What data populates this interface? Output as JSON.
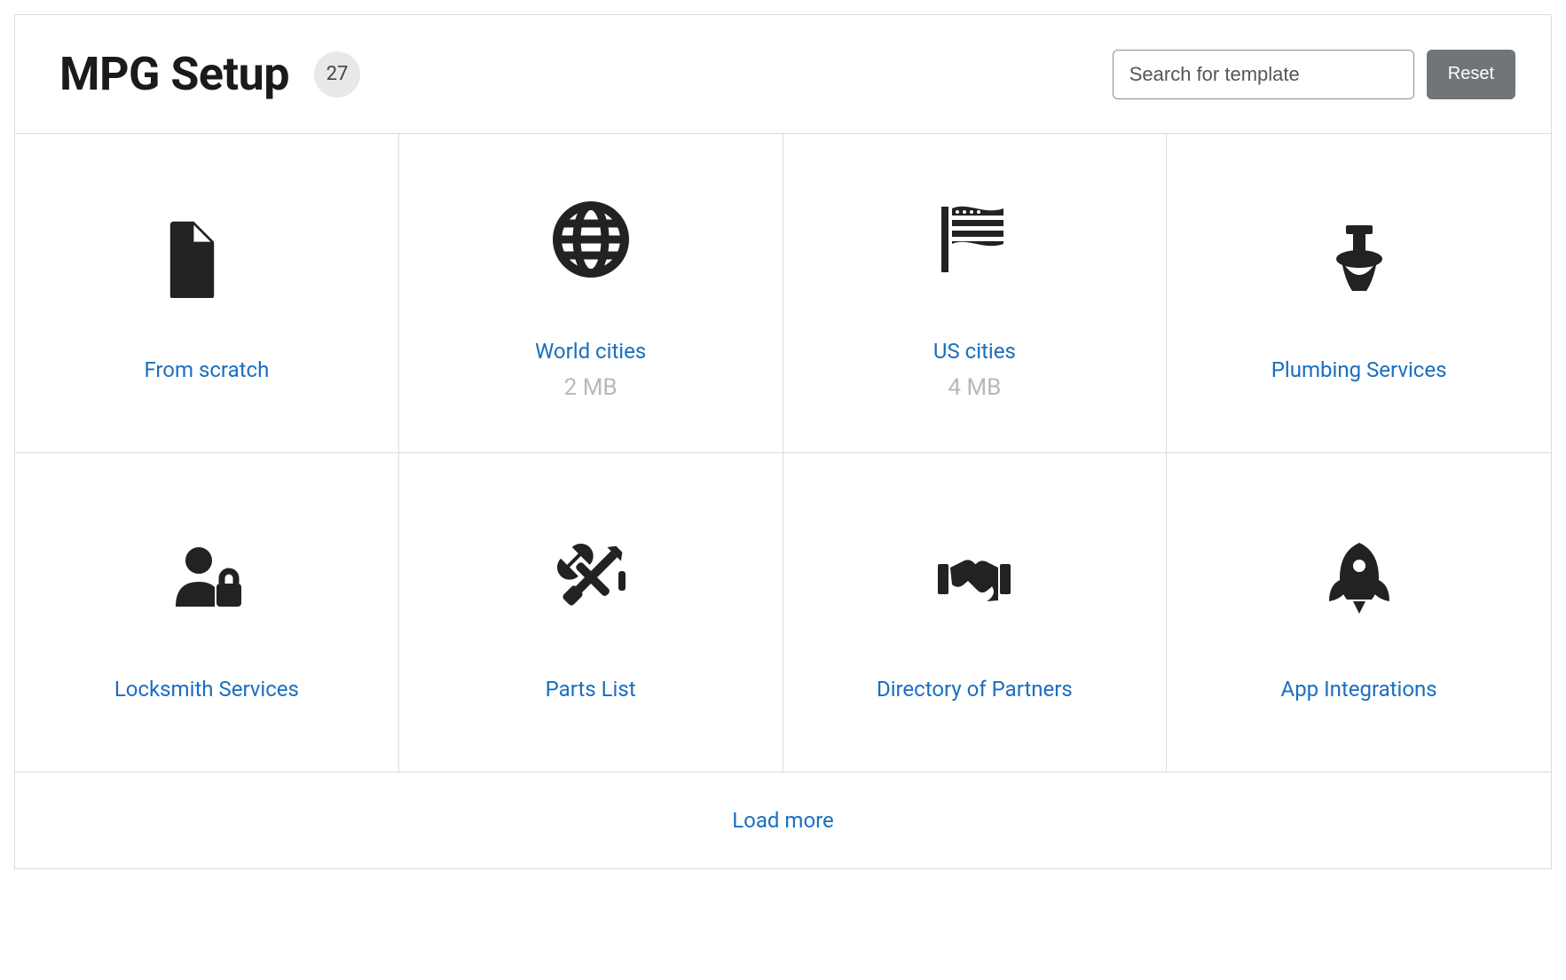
{
  "header": {
    "title": "MPG Setup",
    "count": "27"
  },
  "search": {
    "placeholder": "Search for template",
    "value": ""
  },
  "reset_label": "Reset",
  "cards": [
    {
      "title": "From scratch",
      "sub": "",
      "icon": "file"
    },
    {
      "title": "World cities",
      "sub": "2 MB",
      "icon": "globe"
    },
    {
      "title": "US cities",
      "sub": "4 MB",
      "icon": "flag"
    },
    {
      "title": "Plumbing Services",
      "sub": "",
      "icon": "toilet"
    },
    {
      "title": "Locksmith Services",
      "sub": "",
      "icon": "userlock"
    },
    {
      "title": "Parts List",
      "sub": "",
      "icon": "tools"
    },
    {
      "title": "Directory of Partners",
      "sub": "",
      "icon": "handshake"
    },
    {
      "title": "App Integrations",
      "sub": "",
      "icon": "rocket"
    }
  ],
  "load_more": "Load more"
}
